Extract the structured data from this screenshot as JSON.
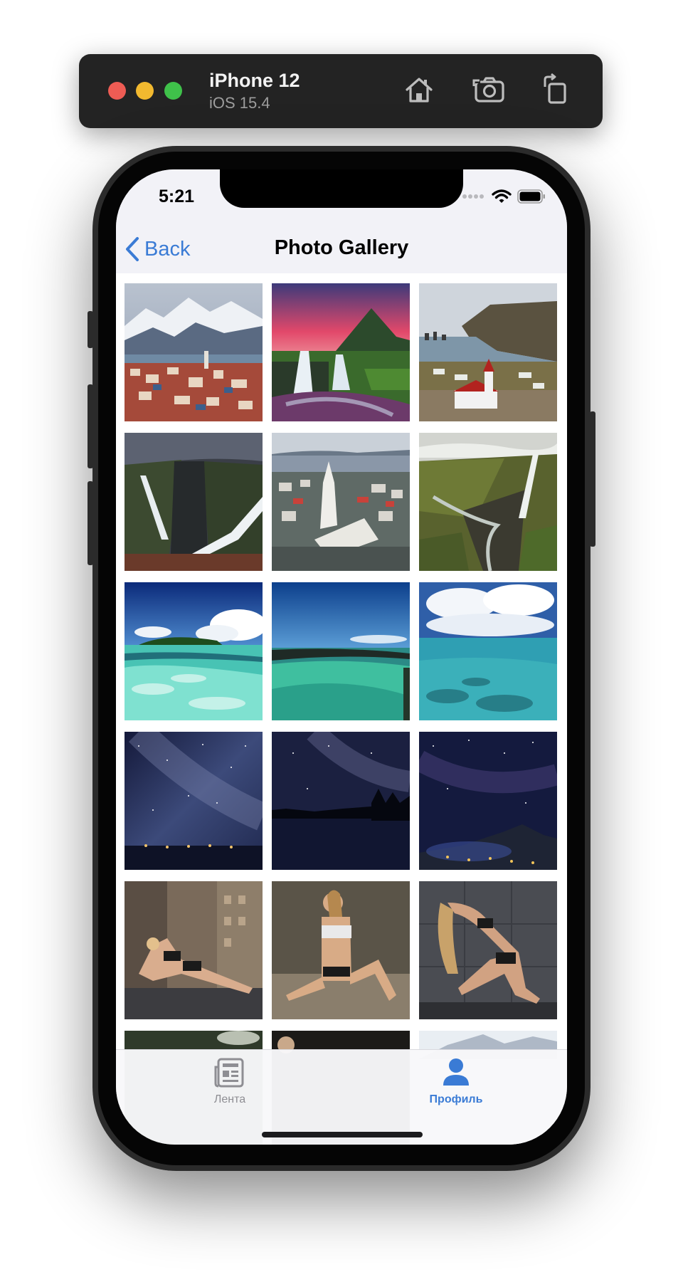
{
  "simulator": {
    "device_name": "iPhone 12",
    "os_version": "iOS 15.4",
    "buttons": [
      "home-icon",
      "screenshot-camera-icon",
      "rotate-icon"
    ]
  },
  "status_bar": {
    "time": "5:21",
    "icons": [
      "signal-dots-icon",
      "wifi-icon",
      "battery-icon"
    ]
  },
  "nav": {
    "back_label": "Back",
    "title": "Photo Gallery"
  },
  "gallery": {
    "photos": [
      "city-mountains",
      "waterfall-sunset",
      "church-coast",
      "canyon-waterfall",
      "church-aerial",
      "gorge-waterfall",
      "tropical-island",
      "turquoise-lagoon",
      "clouds-sea",
      "milky-way-lake",
      "milky-way-reflection",
      "starry-mountain",
      "fitness-plank",
      "fitness-sitting",
      "fitness-stretch"
    ]
  },
  "tabbar": {
    "tabs": [
      {
        "label": "Лента",
        "icon": "newspaper-icon",
        "active": false
      },
      {
        "label": "Профиль",
        "icon": "person-icon",
        "active": true
      }
    ]
  },
  "colors": {
    "accent": "#3a7bd5",
    "inactive": "#8e8e93",
    "nav_bg": "#f2f2f7",
    "sim_bar": "#232323"
  }
}
